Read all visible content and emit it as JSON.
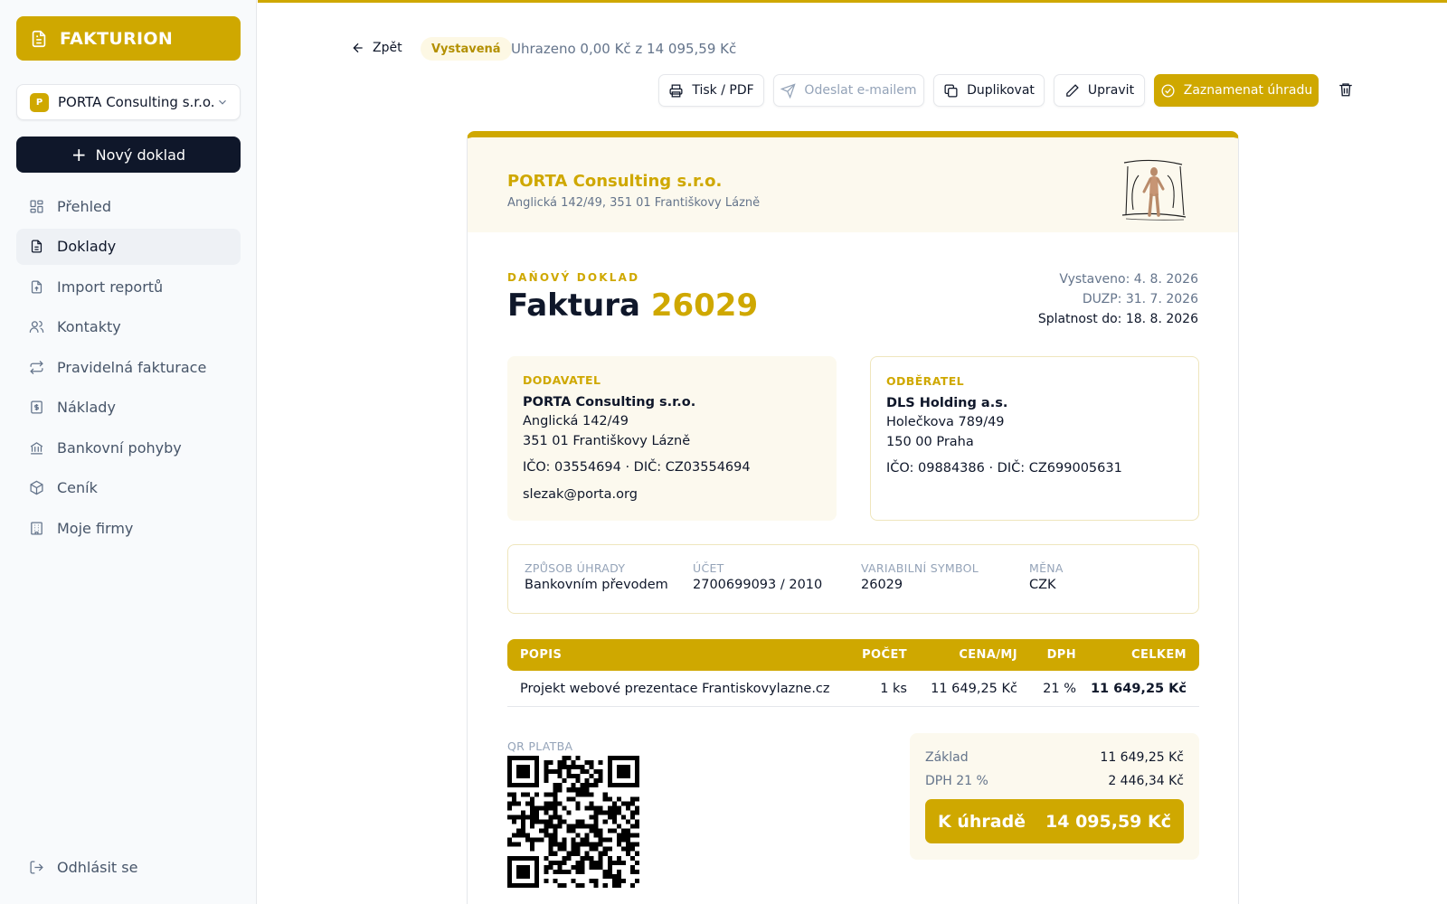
{
  "sidebar": {
    "brand": "FAKTURION",
    "company": {
      "badge": "P",
      "name": "PORTA Consulting s.r.o."
    },
    "new_doc": "Nový doklad",
    "items": [
      {
        "label": "Přehled",
        "icon": "dashboard-icon"
      },
      {
        "label": "Doklady",
        "icon": "document-icon",
        "active": true
      },
      {
        "label": "Import reportů",
        "icon": "file-upload-icon"
      },
      {
        "label": "Kontakty",
        "icon": "users-icon"
      },
      {
        "label": "Pravidelná fakturace",
        "icon": "repeat-icon"
      },
      {
        "label": "Náklady",
        "icon": "receipt-icon"
      },
      {
        "label": "Bankovní pohyby",
        "icon": "bank-icon"
      },
      {
        "label": "Ceník",
        "icon": "box-icon"
      },
      {
        "label": "Moje firmy",
        "icon": "building-icon"
      }
    ],
    "logout": "Odhlásit se"
  },
  "header": {
    "back": "Zpět",
    "status": "Vystavená",
    "paid_info": "Uhrazeno 0,00 Kč z 14 095,59 Kč"
  },
  "toolbar": {
    "print": "Tisk / PDF",
    "email": "Odeslat e-mailem",
    "duplicate": "Duplikovat",
    "edit": "Upravit",
    "record_payment": "Zaznamenat úhradu"
  },
  "invoice": {
    "issuer_name": "PORTA Consulting s.r.o.",
    "issuer_address": "Anglická 142/49, 351 01 Františkovy Lázně",
    "doc_type": "DAŇOVÝ DOKLAD",
    "title_word": "Faktura",
    "number": "26029",
    "issued": "Vystaveno: 4. 8. 2026",
    "duzp": "DUZP: 31. 7. 2026",
    "due": "Splatnost do: 18. 8. 2026",
    "supplier": {
      "label": "DODAVATEL",
      "name": "PORTA Consulting s.r.o.",
      "street": "Anglická 142/49",
      "city": "351 01 Františkovy Lázně",
      "ids": "IČO: 03554694 · DIČ: CZ03554694",
      "email": "slezak@porta.org"
    },
    "customer": {
      "label": "ODBĚRATEL",
      "name": "DLS Holding a.s.",
      "street": "Holečkova 789/49",
      "city": "150 00 Praha",
      "ids": "IČO: 09884386 · DIČ: CZ699005631"
    },
    "payment": {
      "method_label": "ZPŮSOB ÚHRADY",
      "method": "Bankovním převodem",
      "account_label": "ÚČET",
      "account": "2700699093 / 2010",
      "vs_label": "VARIABILNÍ SYMBOL",
      "vs": "26029",
      "currency_label": "MĚNA",
      "currency": "CZK"
    },
    "table": {
      "headers": {
        "desc": "POPIS",
        "qty": "POČET",
        "price": "CENA/MJ",
        "vat": "DPH",
        "total": "CELKEM"
      },
      "rows": [
        {
          "desc": "Projekt webové prezentace Frantiskovylazne.cz",
          "qty": "1 ks",
          "price": "11 649,25 Kč",
          "vat": "21 %",
          "total": "11 649,25 Kč"
        }
      ]
    },
    "qr_label": "QR PLATBA",
    "totals": {
      "base_label": "Základ",
      "base": "11 649,25 Kč",
      "vat_label": "DPH 21 %",
      "vat": "2 446,34 Kč",
      "due_label": "K úhradě",
      "due_amount": "14 095,59 Kč"
    }
  },
  "colors": {
    "accent": "#cfa800",
    "dark": "#0f172a",
    "muted": "#64748b"
  }
}
